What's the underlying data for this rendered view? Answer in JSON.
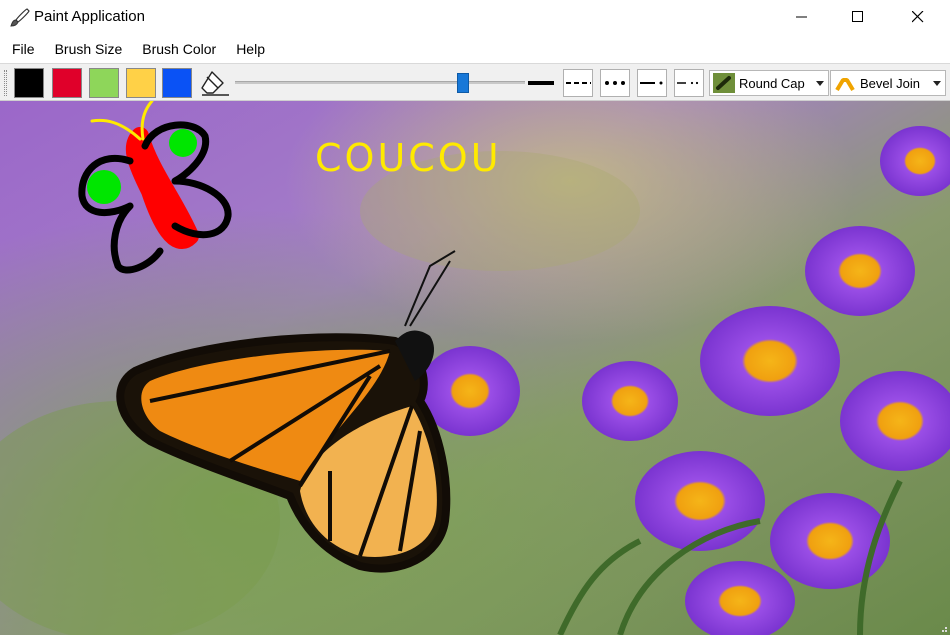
{
  "window": {
    "title": "Paint Application",
    "icon": "paintbrush-icon",
    "controls": [
      "minimize-icon",
      "maximize-icon",
      "close-icon"
    ]
  },
  "menu": {
    "items": [
      "File",
      "Brush Size",
      "Brush Color",
      "Help"
    ]
  },
  "toolbar": {
    "colors": [
      {
        "name": "black",
        "hex": "#000000"
      },
      {
        "name": "red",
        "hex": "#e0002a"
      },
      {
        "name": "green",
        "hex": "#8ed65a"
      },
      {
        "name": "yellow",
        "hex": "#ffd147"
      },
      {
        "name": "blue",
        "hex": "#0a52f5"
      }
    ],
    "eraser_icon": "eraser-icon",
    "brush_size_fraction": 0.8,
    "line_styles": [
      "solid",
      "dash",
      "dot",
      "dash-dot",
      "dash-dot-dot"
    ],
    "cap_select": {
      "icon": "round-cap-icon",
      "value": "Round Cap"
    },
    "join_select": {
      "icon": "bevel-join-icon",
      "value": "Bevel Join"
    }
  },
  "canvas": {
    "background": "monarch butterfly on purple aster flowers photo",
    "annotation_text": "COUCOU",
    "annotation_color": "#ffea00"
  }
}
